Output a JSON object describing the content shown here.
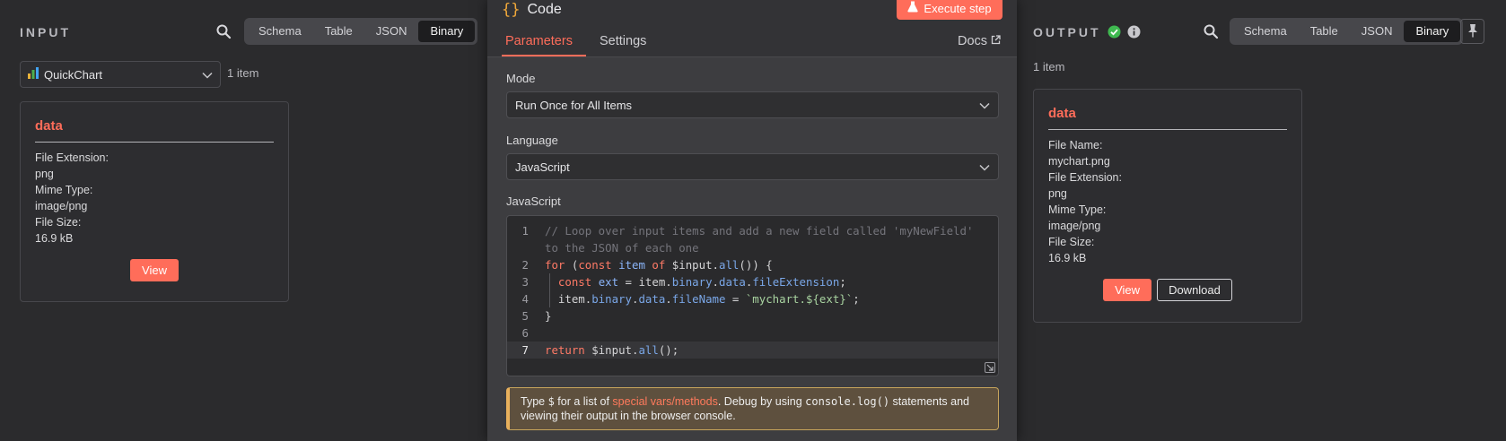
{
  "input": {
    "title": "INPUT",
    "view_tabs": [
      "Schema",
      "Table",
      "JSON",
      "Binary"
    ],
    "active_tab": "Binary",
    "node_select": "QuickChart",
    "item_count": "1 item",
    "card": {
      "key": "data",
      "fields": [
        "File Extension:",
        "png",
        "Mime Type:",
        "image/png",
        "File Size:",
        "16.9 kB"
      ],
      "view_label": "View"
    }
  },
  "output": {
    "title": "OUTPUT",
    "status": "success",
    "view_tabs": [
      "Schema",
      "Table",
      "JSON",
      "Binary"
    ],
    "active_tab": "Binary",
    "item_count": "1 item",
    "card": {
      "key": "data",
      "fields": [
        "File Name:",
        "mychart.png",
        "File Extension:",
        "png",
        "Mime Type:",
        "image/png",
        "File Size:",
        "16.9 kB"
      ],
      "view_label": "View",
      "download_label": "Download"
    }
  },
  "node": {
    "icon_glyph": "{}",
    "name": "Code",
    "execute_label": "Execute step",
    "tabs": [
      "Parameters",
      "Settings"
    ],
    "active_tab": "Parameters",
    "docs_label": "Docs",
    "mode_label": "Mode",
    "mode_value": "Run Once for All Items",
    "language_label": "Language",
    "language_value": "JavaScript",
    "code_label": "JavaScript",
    "code_lines": [
      {
        "n": "1",
        "text": "// Loop over input items and add a new field called 'myNewField'"
      },
      {
        "n": "",
        "text": "to the JSON of each one"
      },
      {
        "n": "2",
        "text": "for (const item of $input.all()) {"
      },
      {
        "n": "3",
        "text": "  const ext = item.binary.data.fileExtension;"
      },
      {
        "n": "4",
        "text": "  item.binary.data.fileName = `mychart.${ext}`;"
      },
      {
        "n": "5",
        "text": "}"
      },
      {
        "n": "6",
        "text": ""
      },
      {
        "n": "7",
        "text": "return $input.all();"
      }
    ],
    "active_line": "7",
    "hint": {
      "pre": "Type ",
      "dollar": "$",
      "mid": " for a list of ",
      "link": "special vars/methods",
      "mid2": ". Debug by using ",
      "code": "console.log()",
      "post": " statements and viewing their output in the browser console."
    }
  },
  "colors": {
    "accent": "#ff6d5a",
    "success": "#3fb950",
    "code_icon": "#f0a83a",
    "chart_icon_bars": [
      "#e8b23a",
      "#4caf50",
      "#42a5f5"
    ]
  }
}
